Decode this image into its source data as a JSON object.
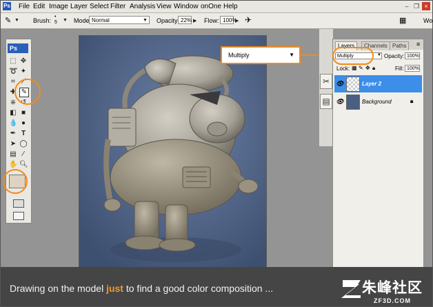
{
  "menubar": {
    "app_badge": "Ps",
    "items": [
      "File",
      "Edit",
      "Image",
      "Layer",
      "Select",
      "Filter",
      "Analysis",
      "View",
      "Window",
      "onOne",
      "Help"
    ]
  },
  "options": {
    "brush_label": "Brush:",
    "brush_size": "5",
    "mode_label": "Mode:",
    "mode_value": "Normal",
    "opacity_label": "Opacity:",
    "opacity_value": "22%",
    "flow_label": "Flow:",
    "flow_value": "100%",
    "workspace_label": "Wo"
  },
  "toolbox": {
    "logo": "Ps",
    "colors": {
      "foreground": "#e0d2c1"
    }
  },
  "callout": {
    "blend_mode": "Multiply"
  },
  "layers_panel": {
    "tabs": [
      "Layers",
      "Channels",
      "Paths"
    ],
    "blend_mode": "Multiply",
    "opacity_label": "Opacity:",
    "opacity_value": "100%",
    "lock_label": "Lock:",
    "fill_label": "Fill:",
    "fill_value": "100%",
    "layers": [
      {
        "name": "Layer 2",
        "selected": true
      },
      {
        "name": "Background",
        "selected": false
      }
    ]
  },
  "caption": {
    "text_before": "Drawing on the model ",
    "highlight": "just",
    "text_after": " to find a good color composition ..."
  },
  "watermark": {
    "chinese": "朱峰社区",
    "domain": "ZF3D.COM"
  },
  "colors": {
    "highlight_orange": "#f28a1a",
    "canvas_bg": "#4b5f82",
    "selected_layer": "#3c8ee8"
  }
}
